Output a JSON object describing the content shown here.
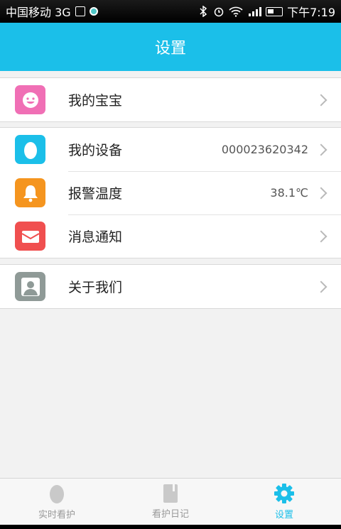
{
  "status_bar": {
    "carrier": "中国移动 3G",
    "time": "下午7:19"
  },
  "header": {
    "title": "设置"
  },
  "menu": [
    {
      "label": "我的宝宝",
      "value": "",
      "icon": "smiley-face-icon",
      "color": "#f06fb5"
    },
    {
      "label": "我的设备",
      "value": "000023620342",
      "icon": "egg-device-icon",
      "color": "#1bbfe9"
    },
    {
      "label": "报警温度",
      "value": "38.1℃",
      "icon": "bell-icon",
      "color": "#f5951f"
    },
    {
      "label": "消息通知",
      "value": "",
      "icon": "envelope-icon",
      "color": "#f04f4f"
    },
    {
      "label": "关于我们",
      "value": "",
      "icon": "person-icon",
      "color": "#8f9a97"
    }
  ],
  "tabs": [
    {
      "label": "实时看护",
      "icon": "egg-icon",
      "active": false
    },
    {
      "label": "看护日记",
      "icon": "notebook-icon",
      "active": false
    },
    {
      "label": "设置",
      "icon": "gear-icon",
      "active": true
    }
  ],
  "colors": {
    "accent": "#1bbfe9"
  }
}
